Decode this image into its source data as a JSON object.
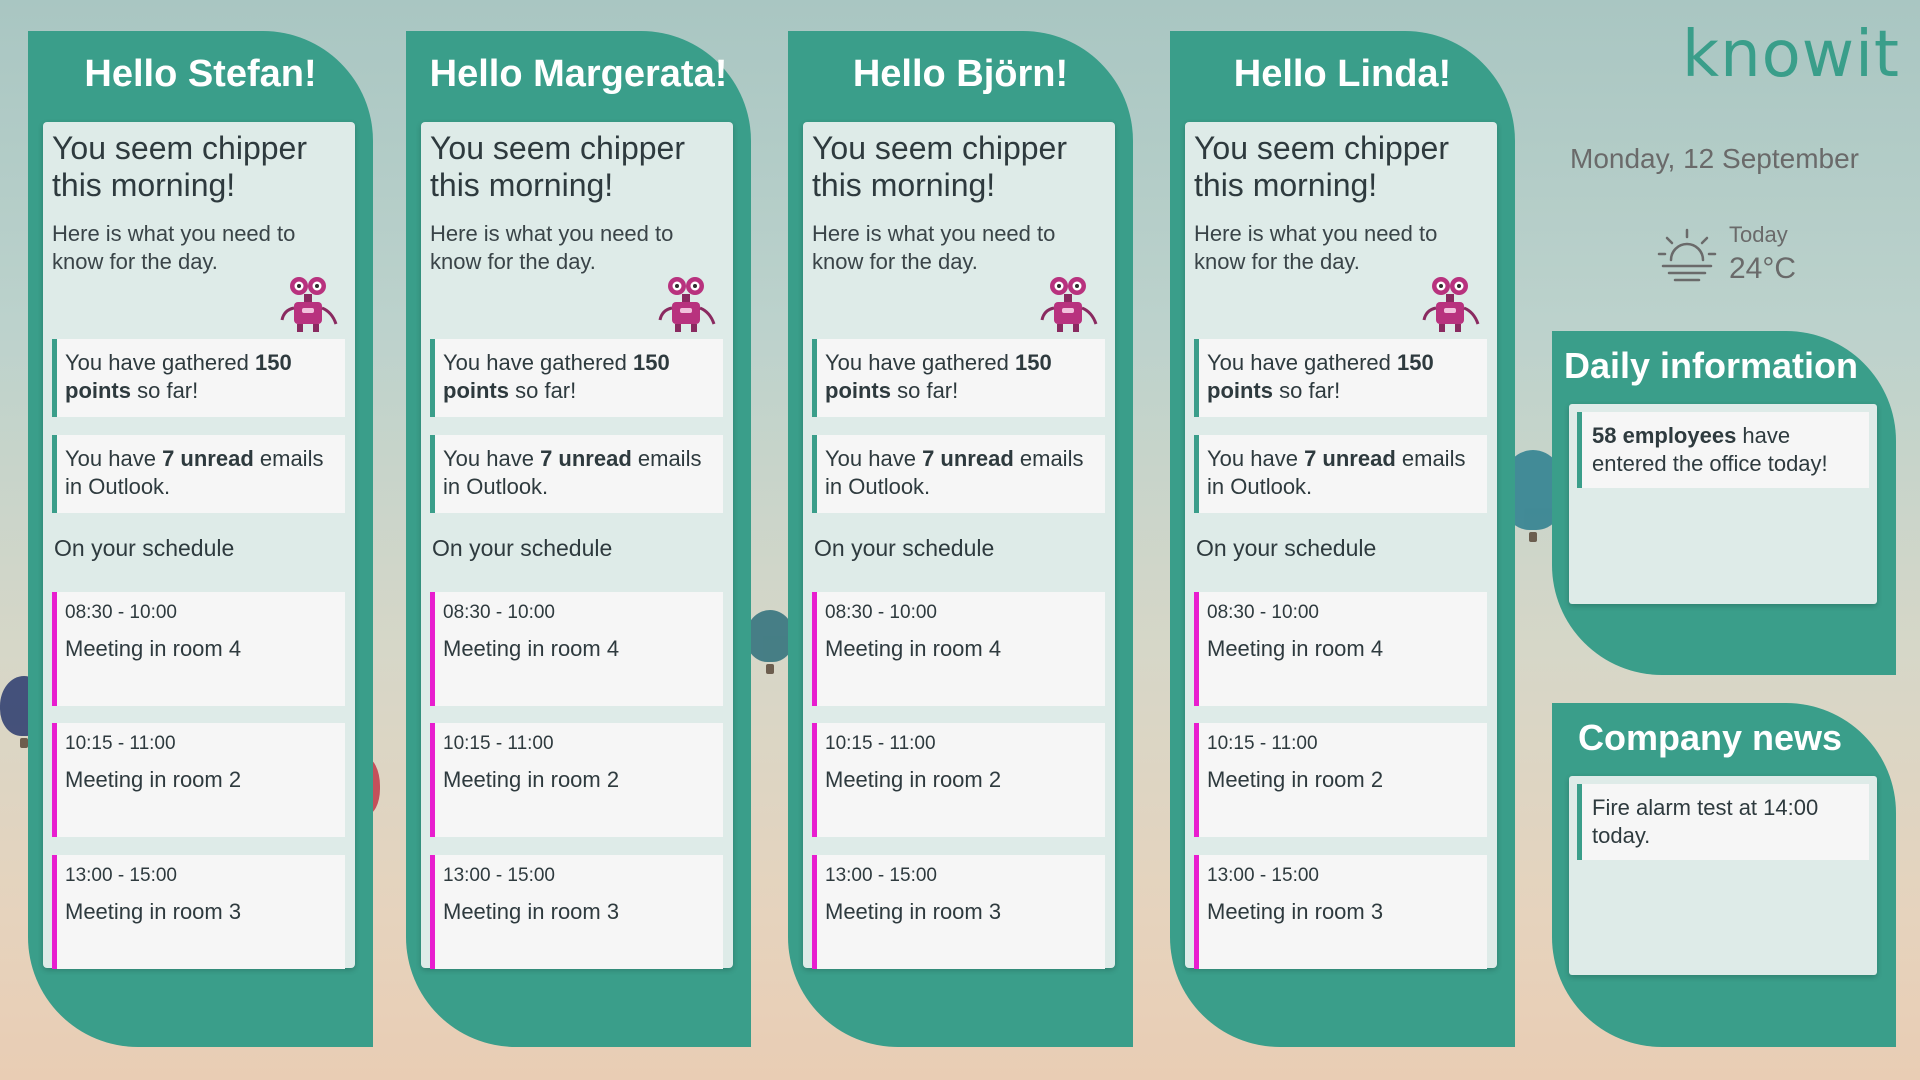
{
  "brand": {
    "logo_text": "knowit",
    "accent": "#3a9e8a",
    "meeting_accent": "#e81ecf"
  },
  "date": "Monday, 12 September",
  "weather": {
    "icon": "sunrise-icon",
    "label": "Today",
    "temperature": "24°C"
  },
  "people": [
    {
      "title": "Hello Stefan!",
      "greeting": "You seem chipper this morning!",
      "subline": "Here is what you need to know for the day.",
      "points": {
        "pre": "You have gathered ",
        "bold": "150 points",
        "post": " so far!"
      },
      "emails": {
        "pre": "You have ",
        "bold": "7 unread",
        "post": " emails in Outlook."
      },
      "schedule_label": "On your schedule",
      "meetings": [
        {
          "time": "08:30 - 10:00",
          "place": "Meeting in room 4"
        },
        {
          "time": "10:15 - 11:00",
          "place": "Meeting in room 2"
        },
        {
          "time": "13:00 - 15:00",
          "place": "Meeting in room 3"
        }
      ]
    },
    {
      "title": "Hello Margerata!",
      "greeting": "You seem chipper this morning!",
      "subline": "Here is what you need to know for the day.",
      "points": {
        "pre": "You have gathered ",
        "bold": "150 points",
        "post": " so far!"
      },
      "emails": {
        "pre": "You have ",
        "bold": "7 unread",
        "post": " emails in Outlook."
      },
      "schedule_label": "On your schedule",
      "meetings": [
        {
          "time": "08:30 - 10:00",
          "place": "Meeting in room 4"
        },
        {
          "time": "10:15 - 11:00",
          "place": "Meeting in room 2"
        },
        {
          "time": "13:00 - 15:00",
          "place": "Meeting in room 3"
        }
      ]
    },
    {
      "title": "Hello Björn!",
      "greeting": "You seem chipper this morning!",
      "subline": "Here is what you need to know for the day.",
      "points": {
        "pre": "You have gathered ",
        "bold": "150 points",
        "post": " so far!"
      },
      "emails": {
        "pre": "You have ",
        "bold": "7 unread",
        "post": " emails in Outlook."
      },
      "schedule_label": "On your schedule",
      "meetings": [
        {
          "time": "08:30 - 10:00",
          "place": "Meeting in room 4"
        },
        {
          "time": "10:15 - 11:00",
          "place": "Meeting in room 2"
        },
        {
          "time": "13:00 - 15:00",
          "place": "Meeting in room 3"
        }
      ]
    },
    {
      "title": "Hello Linda!",
      "greeting": "You seem chipper this morning!",
      "subline": "Here is what you need to know for the day.",
      "points": {
        "pre": "You have gathered ",
        "bold": "150 points",
        "post": " so far!"
      },
      "emails": {
        "pre": "You have ",
        "bold": "7 unread",
        "post": " emails in Outlook."
      },
      "schedule_label": "On your schedule",
      "meetings": [
        {
          "time": "08:30 - 10:00",
          "place": "Meeting in room 4"
        },
        {
          "time": "10:15 - 11:00",
          "place": "Meeting in room 2"
        },
        {
          "time": "13:00 - 15:00",
          "place": "Meeting in room 3"
        }
      ]
    }
  ],
  "daily_information": {
    "title": "Daily information",
    "bold": "58 employees",
    "text": " have entered the office today!"
  },
  "company_news": {
    "title": "Company news",
    "text": "Fire alarm test at 14:00 today."
  }
}
